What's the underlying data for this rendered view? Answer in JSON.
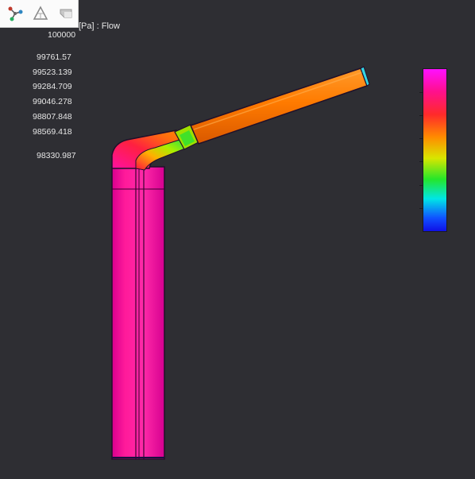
{
  "toolbar": {
    "icons": [
      "branch-icon",
      "triangle-mesh-icon",
      "surface-icon"
    ]
  },
  "legend": {
    "title": "[Pa] : Flow",
    "values": [
      "100000",
      "99761.57",
      "99523.139",
      "99284.709",
      "99046.278",
      "98807.848",
      "98569.418",
      "98330.987"
    ]
  },
  "colors": {
    "background": "#2e2e33",
    "high": "#ff10c8",
    "mid": "#ff8c00",
    "low": "#1010e6"
  }
}
